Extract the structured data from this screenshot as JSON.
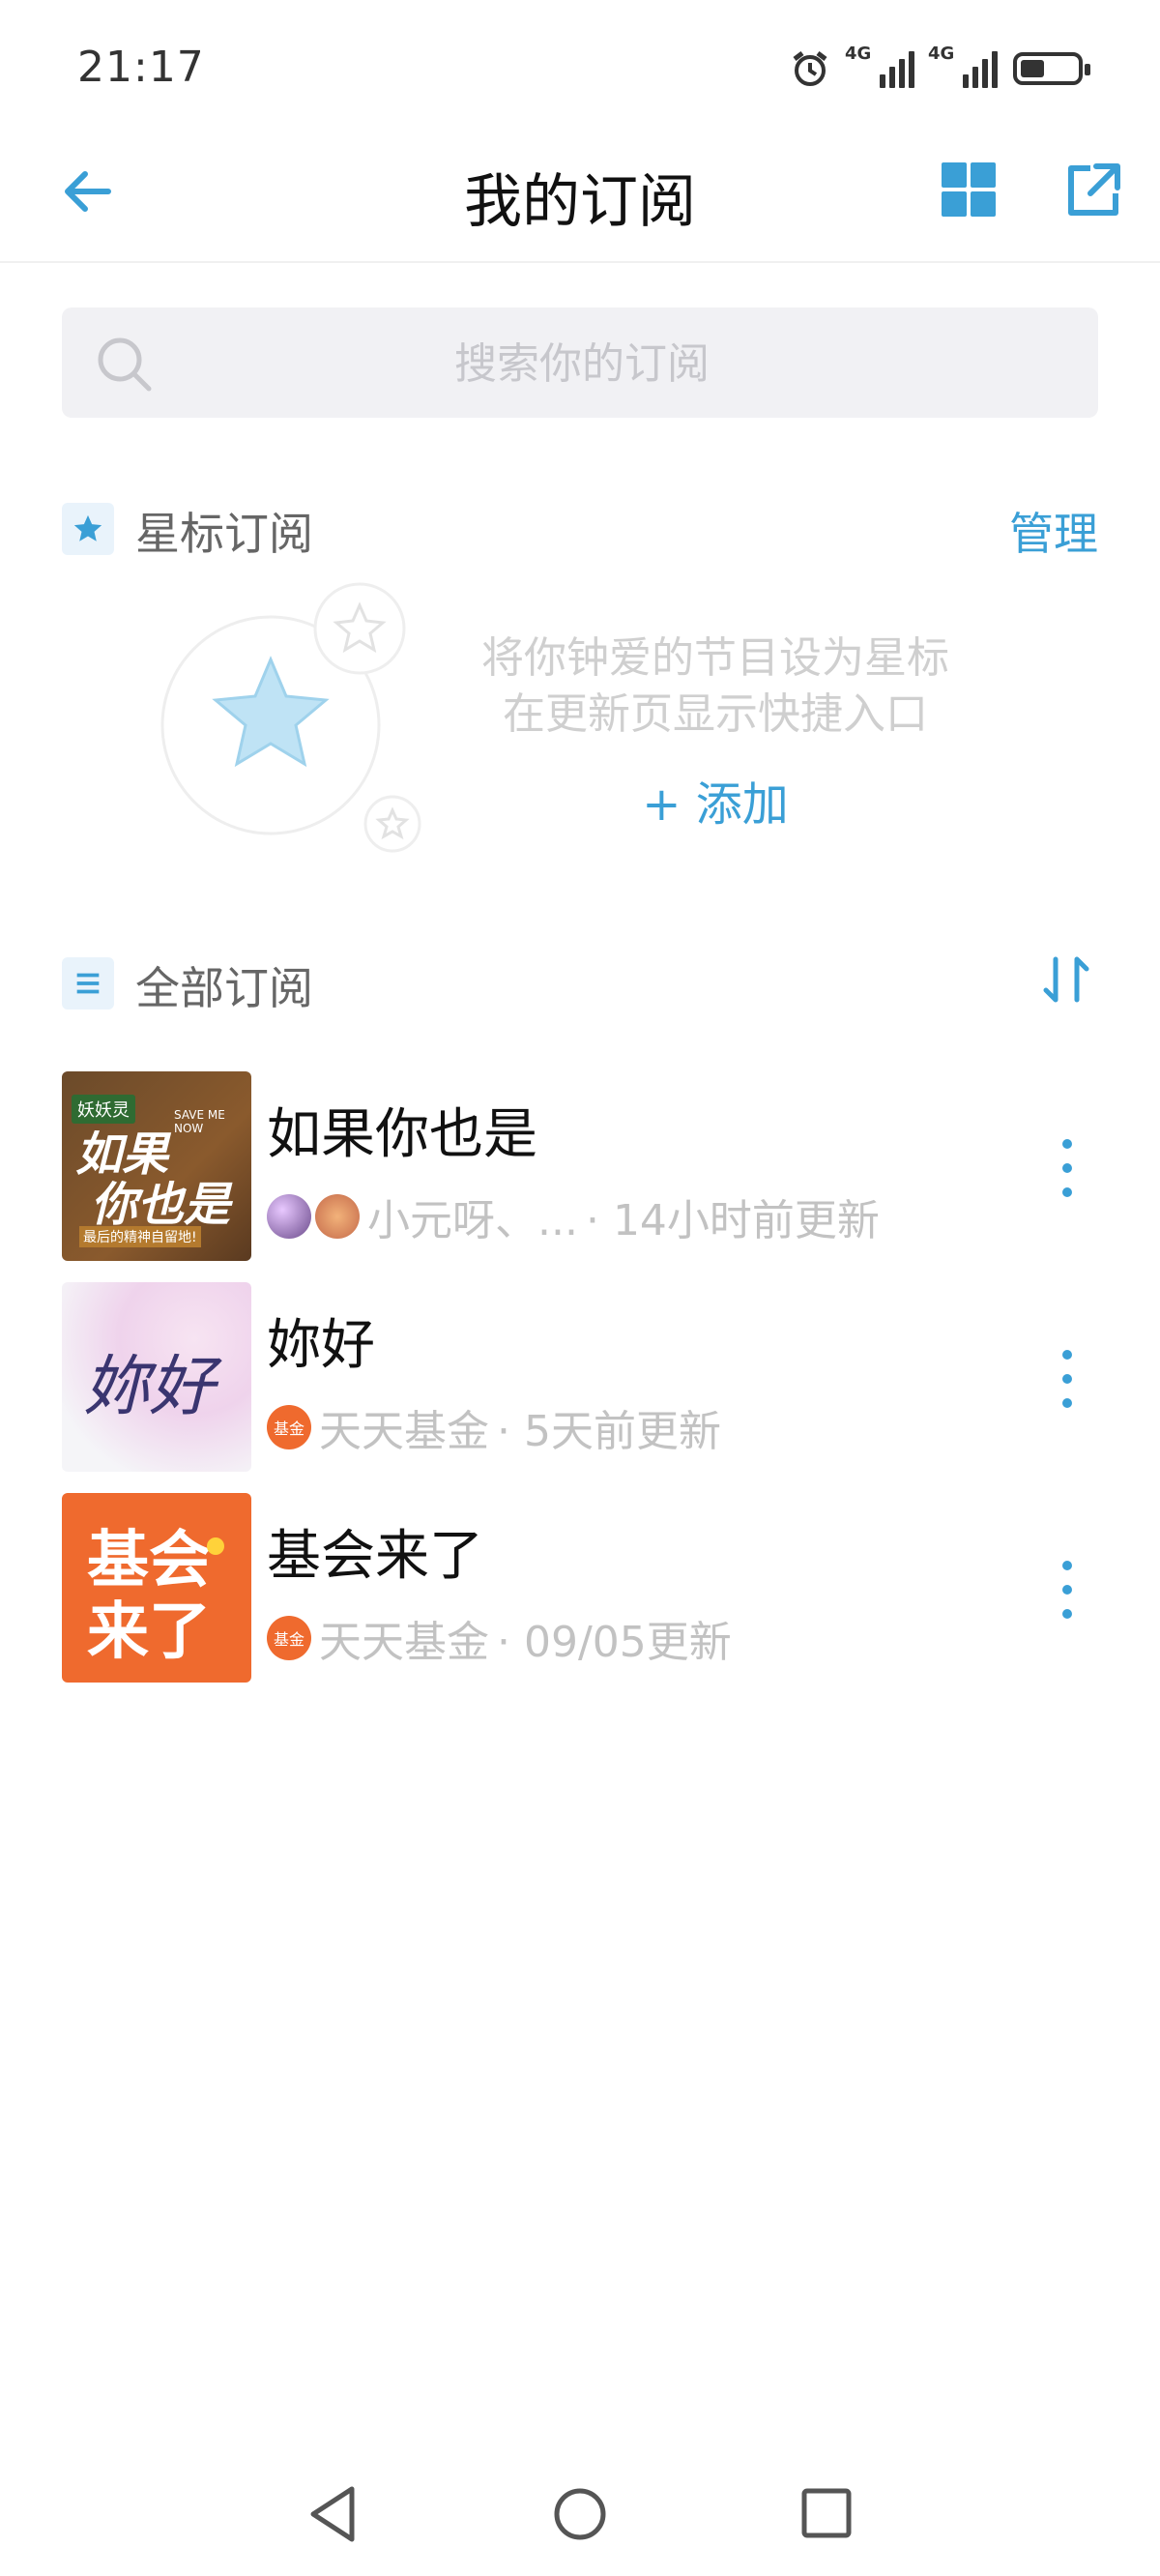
{
  "status": {
    "time": "21:17",
    "net1": "4G",
    "net2": "4G"
  },
  "header": {
    "title": "我的订阅",
    "back_icon": "back-arrow-icon",
    "grid_icon": "grid-icon",
    "share_icon": "share-external-icon"
  },
  "search": {
    "placeholder": "搜索你的订阅",
    "value": ""
  },
  "starred": {
    "title": "星标订阅",
    "manage_label": "管理",
    "hint_line1": "将你钟爱的节目设为星标",
    "hint_line2": "在更新页显示快捷入口",
    "add_label": "+ 添加"
  },
  "all": {
    "title": "全部订阅",
    "sort_icon": "sort-icon"
  },
  "subscriptions": [
    {
      "title": "如果你也是",
      "author": "小元呀、...",
      "update": "· 14小时前更新",
      "thumb_text1": "如果",
      "thumb_text2": "你也是",
      "thumb_tag": "妖妖灵",
      "thumb_sub": "SAVE ME NOW",
      "thumb_foot": "最后的精神自留地!"
    },
    {
      "title": "妳好",
      "author": "天天基金",
      "update": "· 5天前更新",
      "thumb_text1": "妳好",
      "avatar_text": "基金"
    },
    {
      "title": "基会来了",
      "author": "天天基金",
      "update": "· 09/05更新",
      "thumb_text1": "基会",
      "thumb_text2": "来了",
      "avatar_text": "基金"
    }
  ],
  "colors": {
    "accent": "#3a9fd6",
    "orange": "#ef6a2e"
  }
}
